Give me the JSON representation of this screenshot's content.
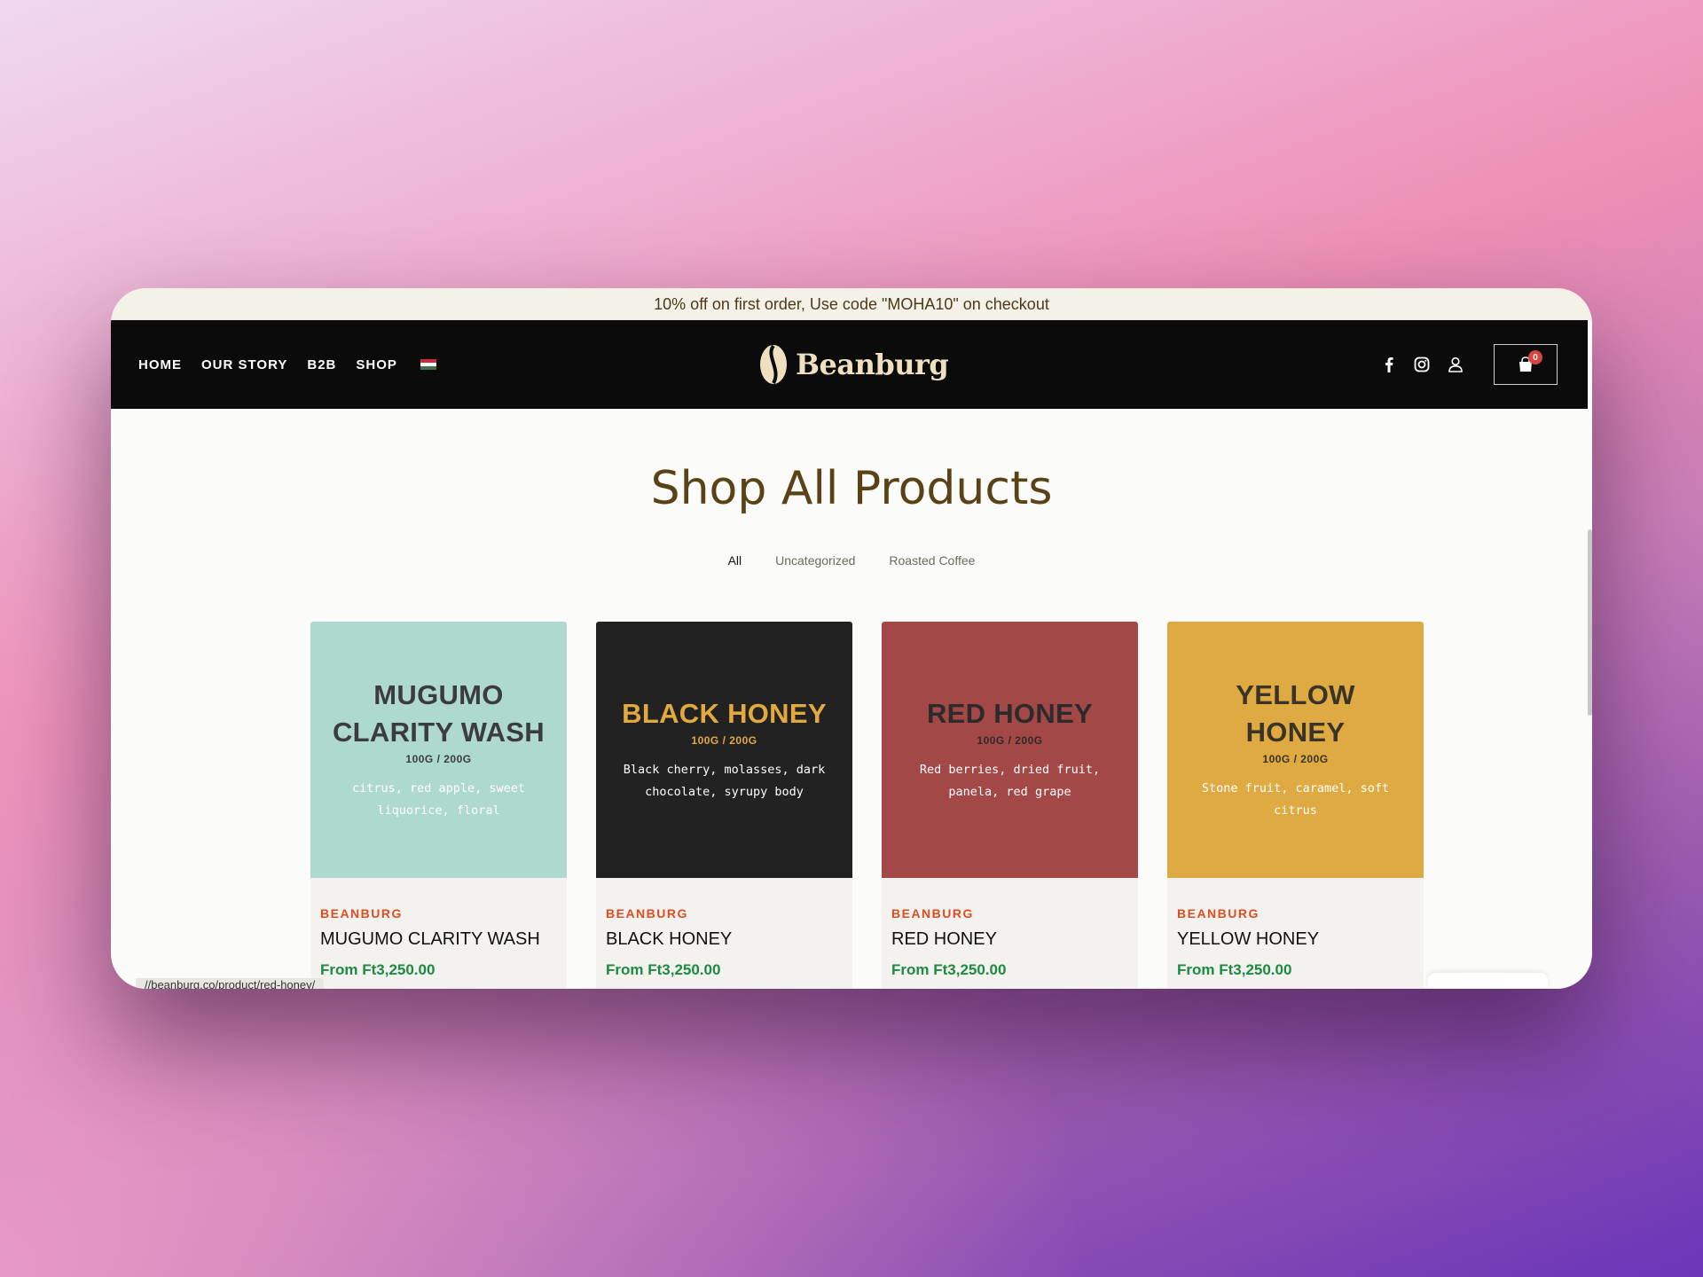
{
  "promo_bar": {
    "text": "10% off on first order, Use code \"MOHA10\" on checkout"
  },
  "nav": {
    "links": [
      "HOME",
      "OUR STORY",
      "B2B",
      "SHOP"
    ],
    "language_flag": "hungary-flag-icon",
    "logo_text": "Beanburg",
    "icons": [
      "facebook-icon",
      "instagram-icon",
      "user-icon"
    ],
    "cart_count": "0"
  },
  "main": {
    "title": "Shop All Products",
    "filters": [
      {
        "label": "All",
        "active": true
      },
      {
        "label": "Uncategorized",
        "active": false
      },
      {
        "label": "Roasted Coffee",
        "active": false
      }
    ]
  },
  "products": [
    {
      "image_name": "MUGUMO CLARITY WASH",
      "image_size": "100G / 200G",
      "image_notes": "citrus, red apple, sweet liquorice, floral",
      "bg_color": "#aed9cf",
      "name_color": "#3c3c3c",
      "size_color": "#3c3c3c",
      "brand": "BEANBURG",
      "title": "MUGUMO CLARITY WASH",
      "price": "From Ft3,250.00"
    },
    {
      "image_name": "BLACK HONEY",
      "image_size": "100G / 200G",
      "image_notes": "Black cherry, molasses, dark chocolate, syrupy body",
      "bg_color": "#222222",
      "name_color": "#e2a93f",
      "size_color": "#e2a93f",
      "brand": "BEANBURG",
      "title": "BLACK HONEY",
      "price": "From Ft3,250.00"
    },
    {
      "image_name": "RED HONEY",
      "image_size": "100G / 200G",
      "image_notes": "Red berries, dried fruit, panela, red grape",
      "bg_color": "#a34747",
      "name_color": "#2b2b2b",
      "size_color": "#2b2b2b",
      "brand": "BEANBURG",
      "title": "RED HONEY",
      "price": "From Ft3,250.00"
    },
    {
      "image_name": "YELLOW HONEY",
      "image_size": "100G / 200G",
      "image_notes": "Stone fruit, caramel, soft citrus",
      "bg_color": "#e0aa42",
      "name_color": "#3a3328",
      "size_color": "#3a3328",
      "brand": "BEANBURG",
      "title": "YELLOW HONEY",
      "price": "From Ft3,250.00"
    }
  ],
  "status_bar": {
    "url": "//beanburg.co/product/red-honey/"
  }
}
